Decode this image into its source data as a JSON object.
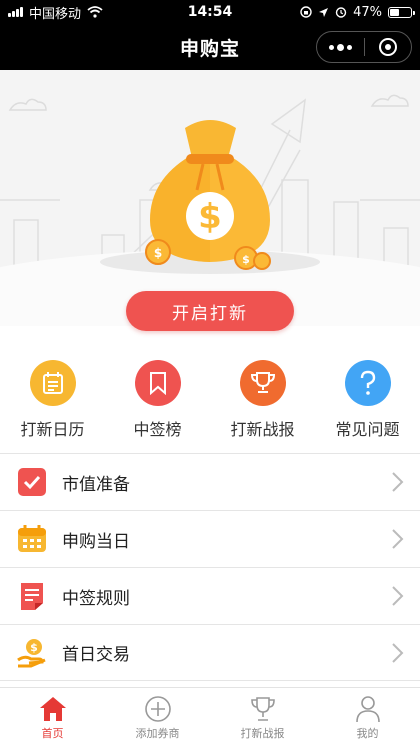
{
  "status": {
    "carrier": "中国移动",
    "time": "14:54",
    "battery": "47%",
    "battery_level": 0.47
  },
  "nav": {
    "title": "申购宝"
  },
  "hero": {
    "start_button": "开启打新"
  },
  "quick_nav": [
    {
      "label": "打新日历",
      "icon": "calendar-icon",
      "color": "#f7b731"
    },
    {
      "label": "中签榜",
      "icon": "bookmark-icon",
      "color": "#ef5350"
    },
    {
      "label": "打新战报",
      "icon": "trophy-icon",
      "color": "#f06b2f"
    },
    {
      "label": "常见问题",
      "icon": "question-icon",
      "color": "#42a5f5"
    }
  ],
  "menu": [
    {
      "label": "市值准备",
      "icon": "checkbox-icon"
    },
    {
      "label": "申购当日",
      "icon": "calendar-grid-icon"
    },
    {
      "label": "中签规则",
      "icon": "document-icon"
    },
    {
      "label": "首日交易",
      "icon": "coin-hand-icon"
    }
  ],
  "tabs": [
    {
      "label": "首页",
      "icon": "home-icon",
      "active": true
    },
    {
      "label": "添加券商",
      "icon": "add-circle-icon",
      "active": false
    },
    {
      "label": "打新战报",
      "icon": "trophy-icon",
      "active": false
    },
    {
      "label": "我的",
      "icon": "user-icon",
      "active": false
    }
  ],
  "colors": {
    "accent": "#ef5350",
    "active_tab": "#e53935",
    "hero_bg": "#f4f4f4"
  }
}
